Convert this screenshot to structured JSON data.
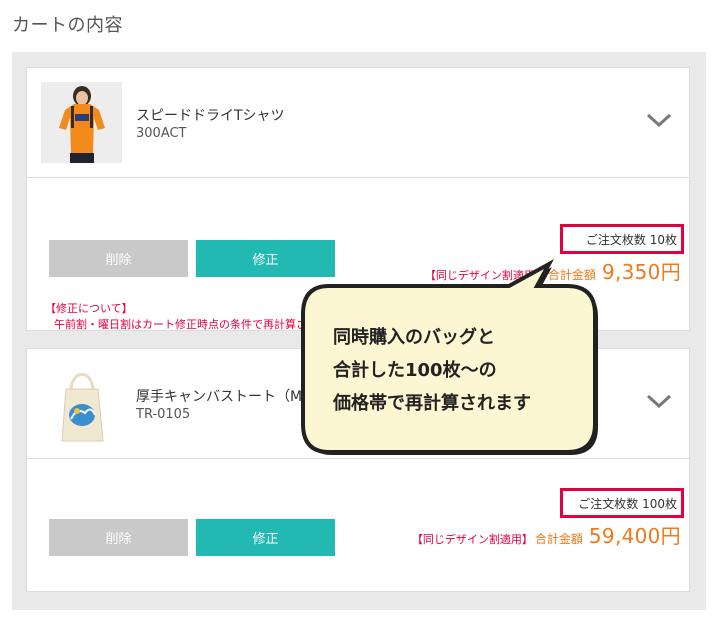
{
  "page": {
    "title": "カートの内容"
  },
  "items": [
    {
      "name": "スピードドライTシャツ",
      "code": "300ACT",
      "thumbnail_icon": "orange-tshirt-photo",
      "delete_label": "削除",
      "edit_label": "修正",
      "quantity_text": "ご注文枚数  10枚",
      "discount_note": "【同じデザイン割適用】",
      "total_label": "合計金額",
      "total_amount": "9,350円"
    },
    {
      "name": "厚手キャンバストート（M）",
      "code": "TR-0105",
      "thumbnail_icon": "canvas-tote-photo",
      "delete_label": "削除",
      "edit_label": "修正",
      "quantity_text": "ご注文枚数  100枚",
      "discount_note": "【同じデザイン割適用】",
      "total_label": "合計金額",
      "total_amount": "59,400円"
    }
  ],
  "notice": {
    "title": "【修正について】",
    "body": "午前割・曜日割はカート修正時点の条件で再計算されます"
  },
  "callout": {
    "lines": [
      "同時購入のバッグと",
      "合計した100枚～の",
      "価格帯で再計算されます"
    ]
  },
  "colors": {
    "accent_teal": "#22b9b3",
    "highlight_red": "#e4003f",
    "price_orange": "#f07a1a",
    "callout_fill": "#fdf6d3"
  }
}
